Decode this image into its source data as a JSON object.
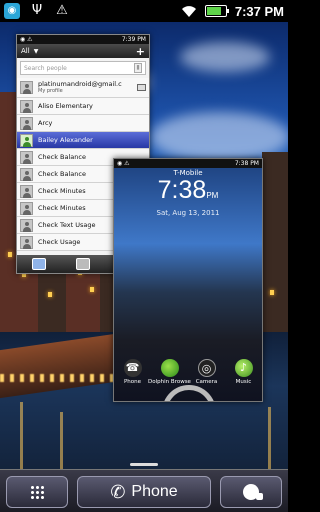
{
  "status_bar": {
    "time": "7:37 PM",
    "icons": [
      "app-notification-icon",
      "usb-icon",
      "warning-icon",
      "wifi-icon",
      "battery-charging-icon"
    ]
  },
  "recent_apps": {
    "people": {
      "mini_time": "7:39 PM",
      "header_title": "All",
      "search_placeholder": "Search people",
      "profile": {
        "name": "platinumandroid@gmail.c",
        "sub": "My profile"
      },
      "contacts": [
        {
          "name": "Aliso Elementary",
          "selected": false
        },
        {
          "name": "Arcy",
          "selected": false
        },
        {
          "name": "Bailey Alexander",
          "selected": true
        },
        {
          "name": "Check Balance",
          "selected": false
        },
        {
          "name": "Check Balance",
          "selected": false
        },
        {
          "name": "Check Minutes",
          "selected": false
        },
        {
          "name": "Check Minutes",
          "selected": false
        },
        {
          "name": "Check Text Usage",
          "selected": false
        },
        {
          "name": "Check Usage",
          "selected": false
        }
      ]
    },
    "lockscreen": {
      "mini_time": "7:38 PM",
      "carrier": "T-Mobile",
      "time": "7:38",
      "ampm": "PM",
      "date": "Sat, Aug 13, 2011",
      "apps": [
        {
          "label": "Phone",
          "icon": "phone-icon"
        },
        {
          "label": "Dolphin Browse",
          "icon": "dolphin-icon"
        },
        {
          "label": "Camera",
          "icon": "camera-icon"
        },
        {
          "label": "Music",
          "icon": "music-icon"
        }
      ]
    }
  },
  "dock": {
    "phone_label": "Phone"
  }
}
